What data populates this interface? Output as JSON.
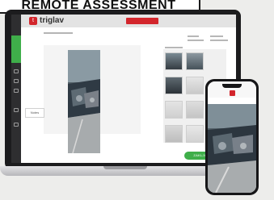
{
  "banner": {
    "text": "REMOTE ASSESSMENT"
  },
  "laptop": {
    "brand": {
      "logo_text": "triglav",
      "logo_mark": "t"
    },
    "tooltip": {
      "text": "Notes"
    },
    "finish_button": {
      "label": "ZAKLJUČI"
    },
    "sidebar_icons": [
      "home-icon",
      "image-icon",
      "list-icon",
      "pen-icon",
      "chat-icon"
    ]
  },
  "phone": {
    "brand": {
      "logo_mark": "t"
    }
  },
  "colors": {
    "accent_green": "#3fae4a",
    "brand_red": "#d3262c",
    "sidebar_dark": "#2e2e30"
  }
}
